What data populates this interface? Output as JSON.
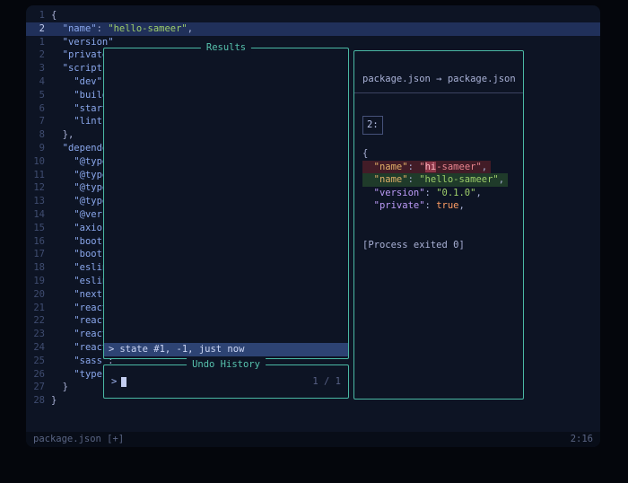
{
  "theme": {
    "outer_bg": "#04060c",
    "editor_bg": "#0d1424",
    "cursorline_bg": "#20305a",
    "float_border": "#4ab8a4",
    "title_teal": "#57c3ae",
    "selection_bg": "#2d4373",
    "diff_removed_bg": "#421c27",
    "diff_added_bg": "#1f3b2a",
    "key_color": "#8aa7ec",
    "string_color": "#9ece6a"
  },
  "buffer": {
    "lines": [
      {
        "num": "1",
        "segments": [
          {
            "t": "{",
            "c": "fg"
          }
        ]
      },
      {
        "num": "2",
        "current": true,
        "segments": [
          {
            "t": "  ",
            "c": "fg"
          },
          {
            "t": "\"name\"",
            "c": "key"
          },
          {
            "t": ": ",
            "c": "fg"
          },
          {
            "t": "\"hello-sameer\"",
            "c": "string"
          },
          {
            "t": ",",
            "c": "fg"
          }
        ]
      },
      {
        "num": "1",
        "segments": [
          {
            "t": "  ",
            "c": "fg"
          },
          {
            "t": "\"version\"",
            "c": "key"
          }
        ]
      },
      {
        "num": "2",
        "segments": [
          {
            "t": "  ",
            "c": "fg"
          },
          {
            "t": "\"private\"",
            "c": "key"
          }
        ]
      },
      {
        "num": "3",
        "segments": [
          {
            "t": "  ",
            "c": "fg"
          },
          {
            "t": "\"scripts\"",
            "c": "key"
          }
        ]
      },
      {
        "num": "4",
        "segments": [
          {
            "t": "    ",
            "c": "fg"
          },
          {
            "t": "\"dev\"",
            "c": "key"
          },
          {
            "t": ":",
            "c": "fg"
          }
        ]
      },
      {
        "num": "5",
        "segments": [
          {
            "t": "    ",
            "c": "fg"
          },
          {
            "t": "\"build\"",
            "c": "key"
          }
        ]
      },
      {
        "num": "6",
        "segments": [
          {
            "t": "    ",
            "c": "fg"
          },
          {
            "t": "\"start\"",
            "c": "key"
          }
        ]
      },
      {
        "num": "7",
        "segments": [
          {
            "t": "    ",
            "c": "fg"
          },
          {
            "t": "\"lint\"",
            "c": "key"
          },
          {
            "t": ":",
            "c": "fg"
          }
        ]
      },
      {
        "num": "8",
        "segments": [
          {
            "t": "  },",
            "c": "fg"
          }
        ]
      },
      {
        "num": "9",
        "segments": [
          {
            "t": "  ",
            "c": "fg"
          },
          {
            "t": "\"dependen",
            "c": "key"
          }
        ]
      },
      {
        "num": "10",
        "segments": [
          {
            "t": "    ",
            "c": "fg"
          },
          {
            "t": "\"@types",
            "c": "key"
          }
        ]
      },
      {
        "num": "11",
        "segments": [
          {
            "t": "    ",
            "c": "fg"
          },
          {
            "t": "\"@types",
            "c": "key"
          }
        ]
      },
      {
        "num": "12",
        "segments": [
          {
            "t": "    ",
            "c": "fg"
          },
          {
            "t": "\"@types",
            "c": "key"
          }
        ]
      },
      {
        "num": "13",
        "segments": [
          {
            "t": "    ",
            "c": "fg"
          },
          {
            "t": "\"@types",
            "c": "key"
          }
        ]
      },
      {
        "num": "14",
        "segments": [
          {
            "t": "    ",
            "c": "fg"
          },
          {
            "t": "\"@verce",
            "c": "key"
          }
        ]
      },
      {
        "num": "15",
        "segments": [
          {
            "t": "    ",
            "c": "fg"
          },
          {
            "t": "\"axios\"",
            "c": "key"
          }
        ]
      },
      {
        "num": "16",
        "segments": [
          {
            "t": "    ",
            "c": "fg"
          },
          {
            "t": "\"bootst",
            "c": "key"
          }
        ]
      },
      {
        "num": "17",
        "segments": [
          {
            "t": "    ",
            "c": "fg"
          },
          {
            "t": "\"bootst",
            "c": "key"
          }
        ]
      },
      {
        "num": "18",
        "segments": [
          {
            "t": "    ",
            "c": "fg"
          },
          {
            "t": "\"eslint",
            "c": "key"
          }
        ]
      },
      {
        "num": "19",
        "segments": [
          {
            "t": "    ",
            "c": "fg"
          },
          {
            "t": "\"eslint",
            "c": "key"
          }
        ]
      },
      {
        "num": "20",
        "segments": [
          {
            "t": "    ",
            "c": "fg"
          },
          {
            "t": "\"next\"",
            "c": "key"
          },
          {
            "t": ":",
            "c": "fg"
          }
        ]
      },
      {
        "num": "21",
        "segments": [
          {
            "t": "    ",
            "c": "fg"
          },
          {
            "t": "\"react\"",
            "c": "key"
          }
        ]
      },
      {
        "num": "22",
        "segments": [
          {
            "t": "    ",
            "c": "fg"
          },
          {
            "t": "\"react-",
            "c": "key"
          }
        ]
      },
      {
        "num": "23",
        "segments": [
          {
            "t": "    ",
            "c": "fg"
          },
          {
            "t": "\"react-",
            "c": "key"
          }
        ]
      },
      {
        "num": "24",
        "segments": [
          {
            "t": "    ",
            "c": "fg"
          },
          {
            "t": "\"react-",
            "c": "key"
          }
        ]
      },
      {
        "num": "25",
        "segments": [
          {
            "t": "    ",
            "c": "fg"
          },
          {
            "t": "\"sass\"",
            "c": "key"
          },
          {
            "t": ":",
            "c": "fg"
          }
        ]
      },
      {
        "num": "26",
        "segments": [
          {
            "t": "    ",
            "c": "fg"
          },
          {
            "t": "\"typesc",
            "c": "key"
          }
        ]
      },
      {
        "num": "27",
        "segments": [
          {
            "t": "  }",
            "c": "fg"
          }
        ]
      },
      {
        "num": "28",
        "segments": [
          {
            "t": "}",
            "c": "fg"
          }
        ]
      }
    ]
  },
  "results_window": {
    "title": "Results",
    "selected": {
      "caret": ">",
      "label": "state #1, -1, just now"
    }
  },
  "prompt_window": {
    "title": "Undo History",
    "caret": ">",
    "query": "",
    "counter": "1 / 1"
  },
  "preview_window": {
    "header": "package.json → package.json",
    "hunk": "2:",
    "diff_lines": [
      {
        "kind": "context",
        "segments": [
          {
            "t": "{",
            "c": "pfg"
          }
        ]
      },
      {
        "kind": "removed",
        "segments": [
          {
            "t": "  \"name\"",
            "c": "dkey"
          },
          {
            "t": ": ",
            "c": "pfg"
          },
          {
            "t": "\"",
            "c": "rstr"
          },
          {
            "t": "hi",
            "c": "remph"
          },
          {
            "t": "-sameer\"",
            "c": "rstr"
          },
          {
            "t": ",",
            "c": "pfg"
          }
        ]
      },
      {
        "kind": "added",
        "segments": [
          {
            "t": "  \"name\"",
            "c": "dkey"
          },
          {
            "t": ": ",
            "c": "pfg"
          },
          {
            "t": "\"hello-sameer\"",
            "c": "astr"
          },
          {
            "t": ",",
            "c": "pfg"
          }
        ]
      },
      {
        "kind": "context",
        "segments": [
          {
            "t": "  \"version\"",
            "c": "vkey"
          },
          {
            "t": ": ",
            "c": "pfg"
          },
          {
            "t": "\"0.1.0\"",
            "c": "str"
          },
          {
            "t": ",",
            "c": "pfg"
          }
        ]
      },
      {
        "kind": "context",
        "segments": [
          {
            "t": "  \"private\"",
            "c": "vkey"
          },
          {
            "t": ": ",
            "c": "pfg"
          },
          {
            "t": "true",
            "c": "bool"
          },
          {
            "t": ",",
            "c": "pfg"
          }
        ]
      }
    ],
    "exit_message": "[Process exited 0]"
  },
  "statusline": {
    "left": "package.json [+]",
    "right": "2:16"
  }
}
